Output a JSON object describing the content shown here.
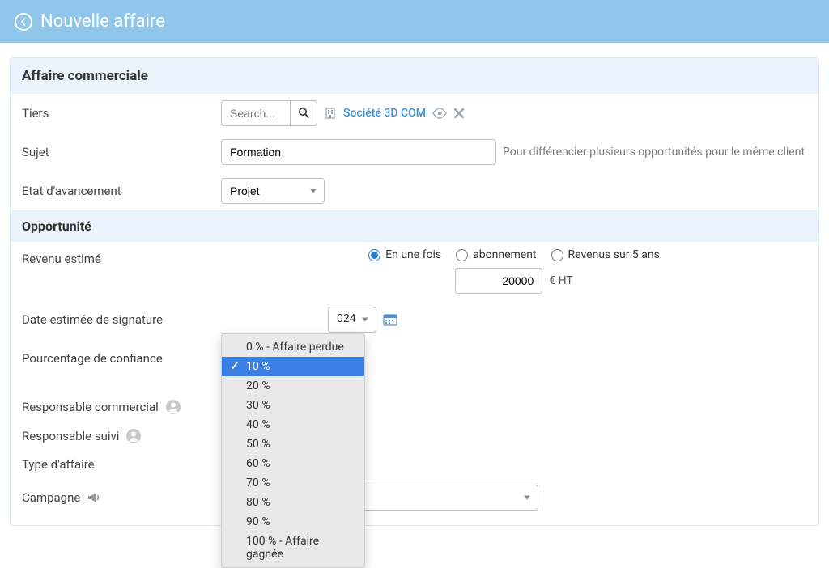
{
  "header": {
    "title": "Nouvelle affaire"
  },
  "sections": {
    "affaire": "Affaire commerciale",
    "opportunite": "Opportunité"
  },
  "labels": {
    "tiers": "Tiers",
    "sujet": "Sujet",
    "etat": "Etat d'avancement",
    "revenu": "Revenu estimé",
    "date_sig": "Date estimée de signature",
    "confiance": "Pourcentage de confiance",
    "resp_com": "Responsable commercial",
    "resp_suivi": "Responsable suivi",
    "type_affaire": "Type d'affaire",
    "campagne": "Campagne"
  },
  "tiers": {
    "search_placeholder": "Search...",
    "company_link": "Société 3D COM"
  },
  "sujet": {
    "value": "Formation",
    "hint": "Pour différencier plusieurs opportunités pour le même client"
  },
  "etat": {
    "value": "Projet"
  },
  "revenu": {
    "options": {
      "once": "En une fois",
      "abo": "abonnement",
      "five": "Revenus sur 5 ans"
    },
    "selected": "once",
    "amount": "20000",
    "currency": "€ HT"
  },
  "date_sig": {
    "year": "024"
  },
  "confidence_dropdown": {
    "items": [
      "0 % - Affaire perdue",
      "10 %",
      "20 %",
      "30 %",
      "40 %",
      "50 %",
      "60 %",
      "70 %",
      "80 %",
      "90 %",
      "100 % - Affaire gagnée"
    ],
    "selected_index": 1
  },
  "icons": {
    "back": "back-arrow",
    "search": "search",
    "building": "building",
    "eye": "eye",
    "close": "close-x",
    "calendar": "calendar",
    "avatar": "avatar",
    "horn": "bullhorn",
    "chevron": "chevron-down"
  }
}
